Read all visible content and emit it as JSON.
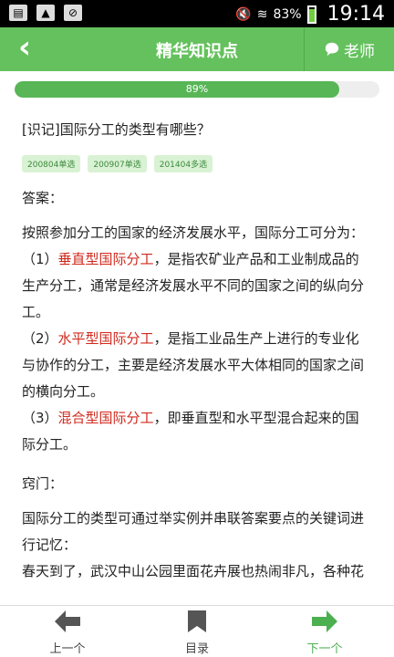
{
  "status": {
    "battery": "83%",
    "time": "19:14",
    "icons": [
      "message-icon",
      "image-icon",
      "no-photo-icon"
    ]
  },
  "header": {
    "title": "精华知识点",
    "teacher_label": "老师"
  },
  "progress": {
    "value": 89,
    "label": "89%"
  },
  "question": "[识记]国际分工的类型有哪些？",
  "tags": [
    "200804单选",
    "200907单选",
    "201404多选"
  ],
  "answer_label": "答案：",
  "answer": {
    "intro": "按照参加分工的国家的经济发展水平，国际分工可分为：",
    "items": [
      {
        "num": "（1）",
        "term": "垂直型国际分工",
        "rest": "，是指农矿业产品和工业制成品的",
        "lines": [
          "生产分工，通常是经济发展水平不同的国家之间的纵向分",
          "工。"
        ]
      },
      {
        "num": "（2）",
        "term": "水平型国际分工",
        "rest": "，是指工业品生产上进行的专业化",
        "lines": [
          "与协作的分工，主要是经济发展水平大体相同的国家之间",
          "的横向分工。"
        ]
      },
      {
        "num": "（3）",
        "term": "混合型国际分工",
        "rest": "，即垂直型和水平型混合起来的国",
        "lines": [
          "际分工。"
        ]
      }
    ]
  },
  "tips_label": "窍门：",
  "tips": {
    "lines": [
      "国际分工的类型可通过举实例并串联答案要点的关键词进",
      "行记忆：",
      "春天到了，武汉中山公园里面花卉展也热闹非凡，各种花"
    ]
  },
  "nav": {
    "prev": "上一个",
    "menu": "目录",
    "next": "下一个"
  }
}
